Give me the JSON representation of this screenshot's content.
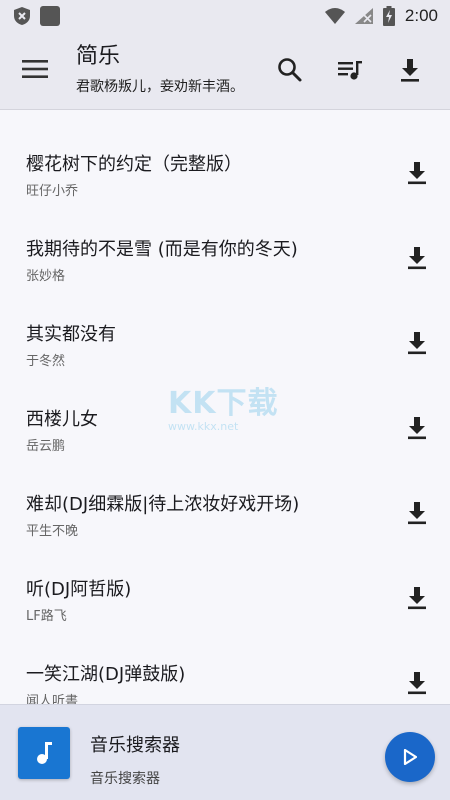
{
  "status_bar": {
    "time": "2:00",
    "battery_level": "⚡"
  },
  "app_bar": {
    "title": "简乐",
    "subtitle": "君歌杨叛儿，妾劝新丰酒。",
    "icons": [
      "menu-icon",
      "search-icon",
      "queue-music-icon",
      "download-icon"
    ]
  },
  "songs": [
    {
      "title": "樱花树下的约定（完整版）",
      "artist": "旺仔小乔"
    },
    {
      "title": "我期待的不是雪 (而是有你的冬天)",
      "artist": "张妙格"
    },
    {
      "title": "其实都没有",
      "artist": "于冬然"
    },
    {
      "title": "西楼儿女",
      "artist": "岳云鹏"
    },
    {
      "title": "难却(DJ细霖版|待上浓妆好戏开场)",
      "artist": "平生不晚"
    },
    {
      "title": "听(DJ阿哲版)",
      "artist": "LF路飞"
    },
    {
      "title": "一笑江湖(DJ弹鼓版)",
      "artist": "闻人听書"
    }
  ],
  "watermark": {
    "logo": "KK下载",
    "url": "www.kkx.net"
  },
  "player": {
    "title": "音乐搜索器",
    "subtitle": "音乐搜索器"
  },
  "colors": {
    "accent": "#1a67c9",
    "app_bar_bg": "#e9e9f0",
    "player_bg": "#e2e4f0"
  }
}
